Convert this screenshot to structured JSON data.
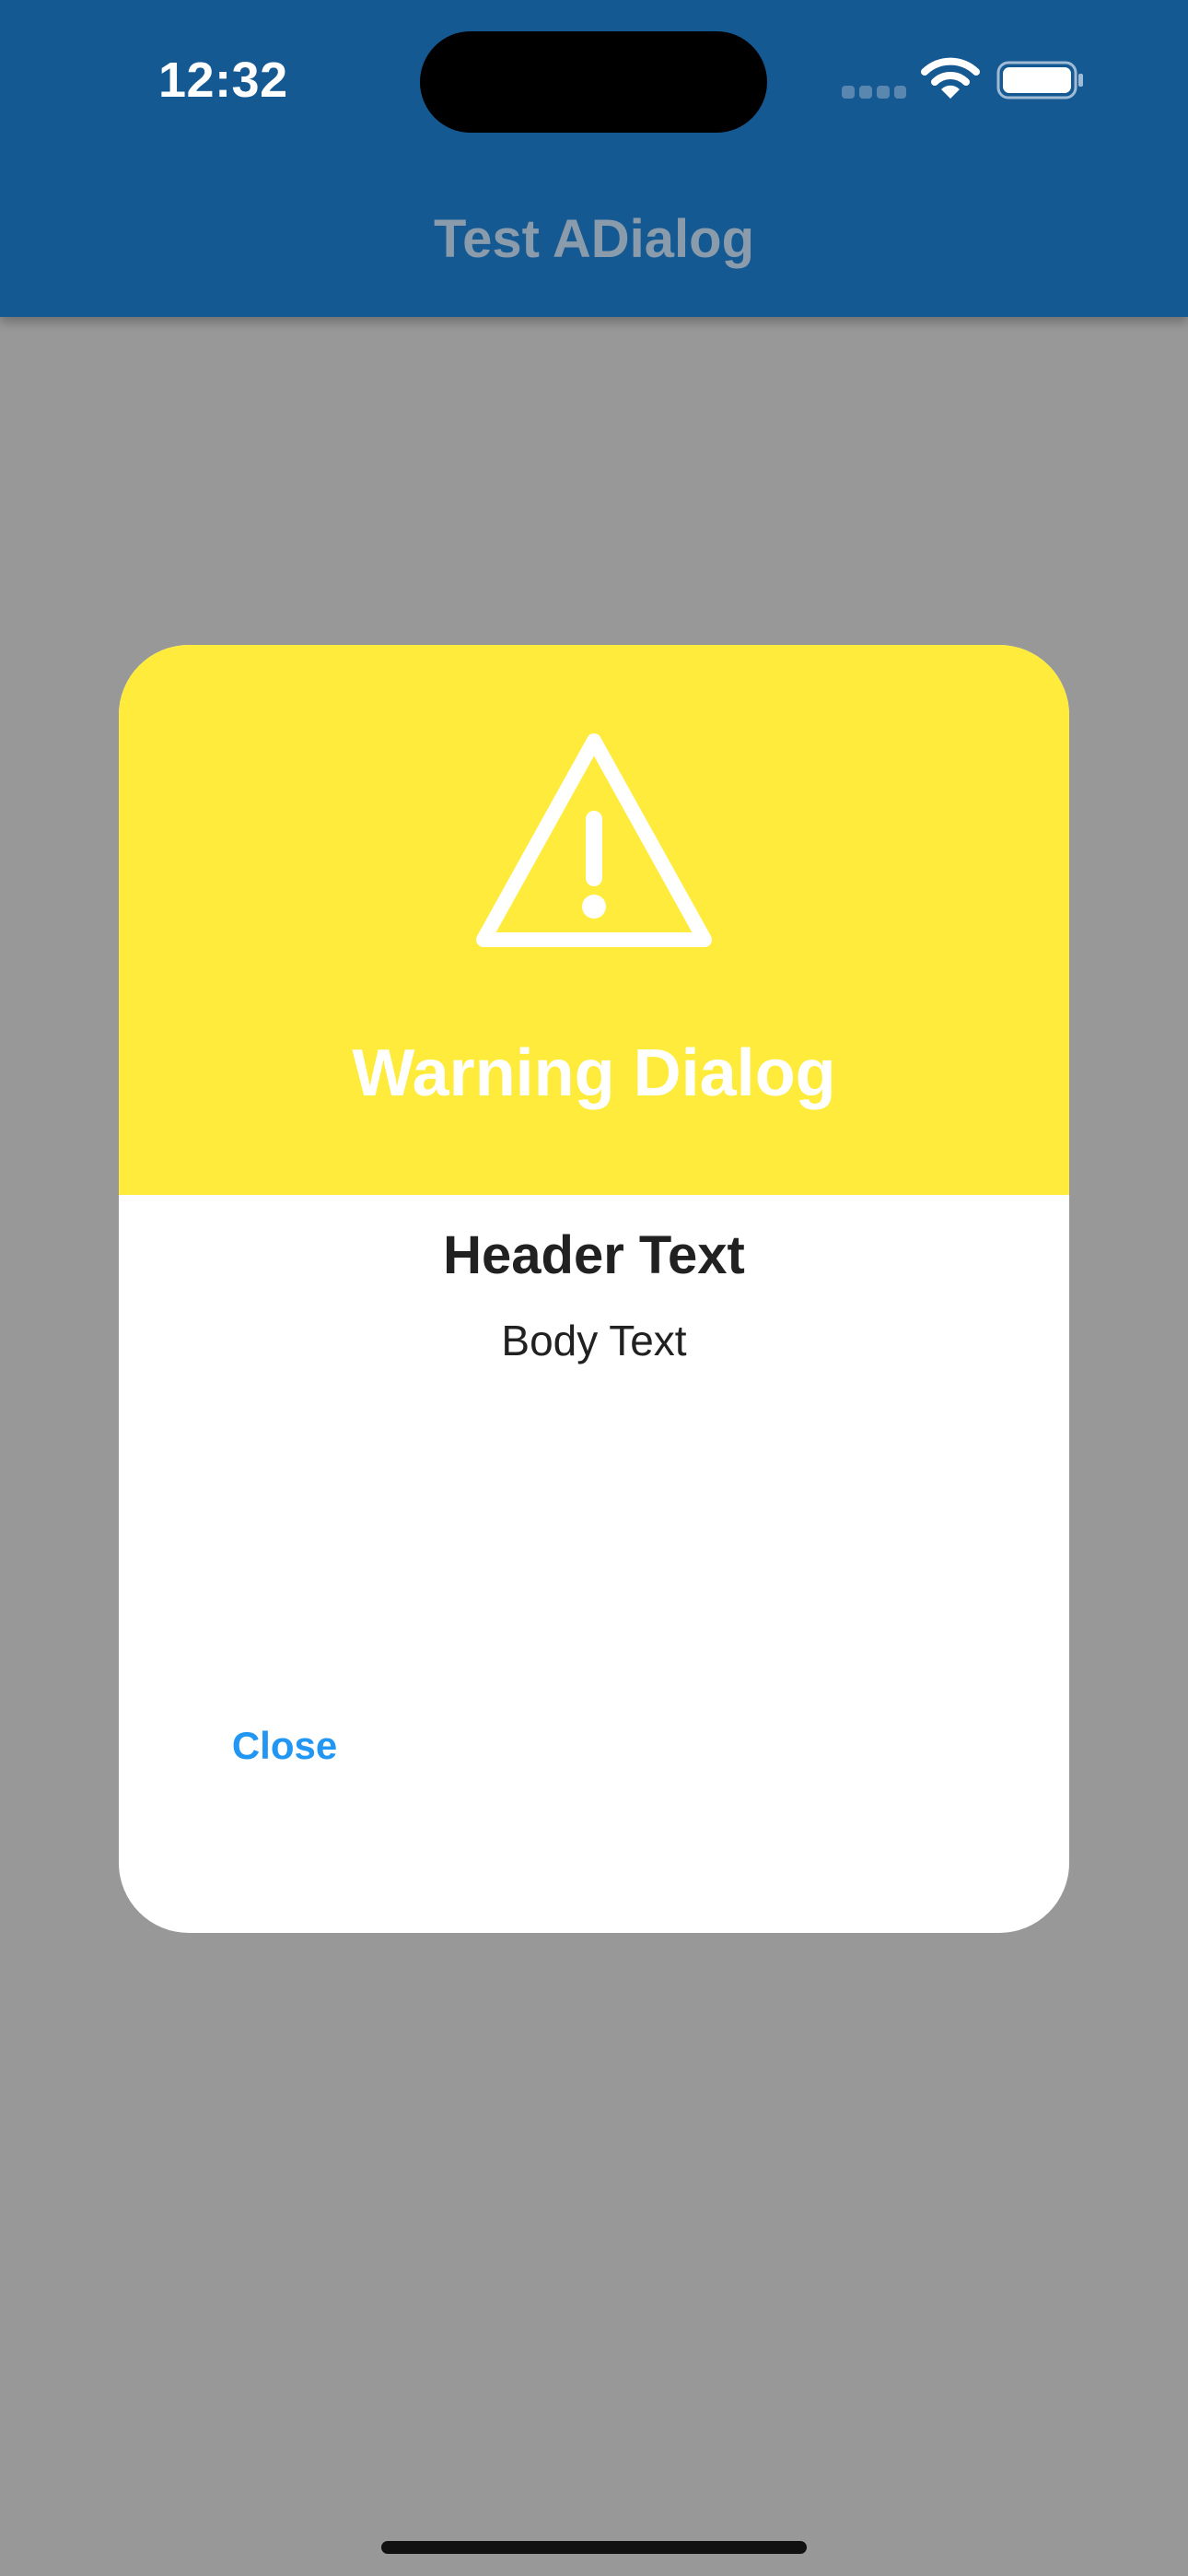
{
  "status_bar": {
    "time": "12:32",
    "icons": [
      "cellular-signal-icon",
      "wifi-icon",
      "battery-icon"
    ]
  },
  "app_bar": {
    "title": "Test ADialog"
  },
  "dialog": {
    "icon": "warning-triangle-icon",
    "title": "Warning Dialog",
    "header_text": "Header Text",
    "body_text": "Body Text",
    "close_label": "Close"
  },
  "colors": {
    "app_bar": "#155993",
    "scrim": "#989898",
    "dialog_header": "#ffeb3b",
    "close_button": "#2196f3"
  }
}
